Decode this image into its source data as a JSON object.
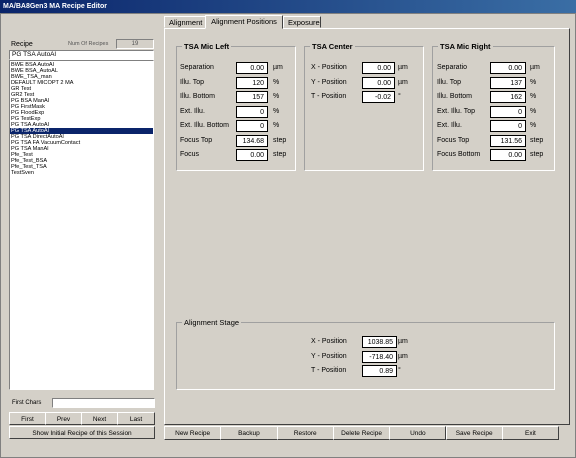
{
  "window": {
    "title": "MA/BA8Gen3 MA Recipe Editor"
  },
  "recipe_panel": {
    "recipe_label": "Recipe",
    "num_label": "Num Of Recipes",
    "num_value": "19",
    "current_recipe": "PG TSA AutoAl",
    "items": [
      "BWE BSA AutoAl",
      "BWE BSA_AutoAL",
      "BWE_TSA_man",
      "DEFAULT MICOPT 2 MA",
      "GR Test",
      "GR2 Test",
      "PG BSA ManAl",
      "PG FirstMask",
      "PG FloodExp",
      "PG TestExp",
      "PG TSA AutoAl",
      "PG TSA AutoAl",
      "PG TSA DirectAutoAl",
      "PG TSA FA VacuumContact",
      "PG TSA ManAl",
      "Pfe_Test",
      "Pfe_Test_BSA",
      "Pfe_Test_TSA",
      "TestSven"
    ],
    "selected_index": 11,
    "first_chars_label": "First Chars",
    "first_chars_value": "",
    "nav_buttons": [
      "First",
      "Prev",
      "Next",
      "Last"
    ],
    "show_initial_label": "Show Initial Recipe of this Session"
  },
  "tabs": [
    "Alignment",
    "Alignment Positions",
    "Exposure"
  ],
  "active_tab": 1,
  "tsa_mic_left": {
    "title": "TSA Mic Left",
    "rows": [
      {
        "label": "Separation",
        "value": "0.00",
        "unit": "µm"
      },
      {
        "label": "Illu. Top",
        "value": "120",
        "unit": "%"
      },
      {
        "label": "Illu. Bottom",
        "value": "157",
        "unit": "%"
      },
      {
        "label": "Ext. Illu.",
        "value": "0",
        "unit": "%"
      },
      {
        "label": "Ext. Illu. Bottom",
        "value": "0",
        "unit": "%"
      },
      {
        "label": "Focus Top",
        "value": "134.68",
        "unit": "step"
      },
      {
        "label": "Focus",
        "value": "0.00",
        "unit": "step"
      }
    ]
  },
  "tsa_center": {
    "title": "TSA Center",
    "rows": [
      {
        "label": "X - Position",
        "value": "0.00",
        "unit": "µm"
      },
      {
        "label": "Y - Position",
        "value": "0.00",
        "unit": "µm"
      },
      {
        "label": "T - Position",
        "value": "-0.02",
        "unit": "°"
      }
    ]
  },
  "tsa_mic_right": {
    "title": "TSA Mic Right",
    "rows": [
      {
        "label": "Separatio",
        "value": "0.00",
        "unit": "µm"
      },
      {
        "label": "Illu. Top",
        "value": "137",
        "unit": "%"
      },
      {
        "label": "Illu. Bottom",
        "value": "162",
        "unit": "%"
      },
      {
        "label": "Ext. Illu. Top",
        "value": "0",
        "unit": "%"
      },
      {
        "label": "Ext. Illu.",
        "value": "0",
        "unit": "%"
      },
      {
        "label": "Focus Top",
        "value": "131.56",
        "unit": "step"
      },
      {
        "label": "Focus Bottom",
        "value": "0.00",
        "unit": "step"
      }
    ]
  },
  "alignment_stage": {
    "title": "Alignment Stage",
    "rows": [
      {
        "label": "X - Position",
        "value": "1038.85",
        "unit": "µm"
      },
      {
        "label": "Y - Position",
        "value": "-718.40",
        "unit": "µm"
      },
      {
        "label": "T - Position",
        "value": "0.89",
        "unit": "°"
      }
    ]
  },
  "bottom_buttons": [
    "New Recipe",
    "Backup",
    "Restore",
    "Delete Recipe",
    "Undo",
    "Save Recipe",
    "Exit"
  ]
}
